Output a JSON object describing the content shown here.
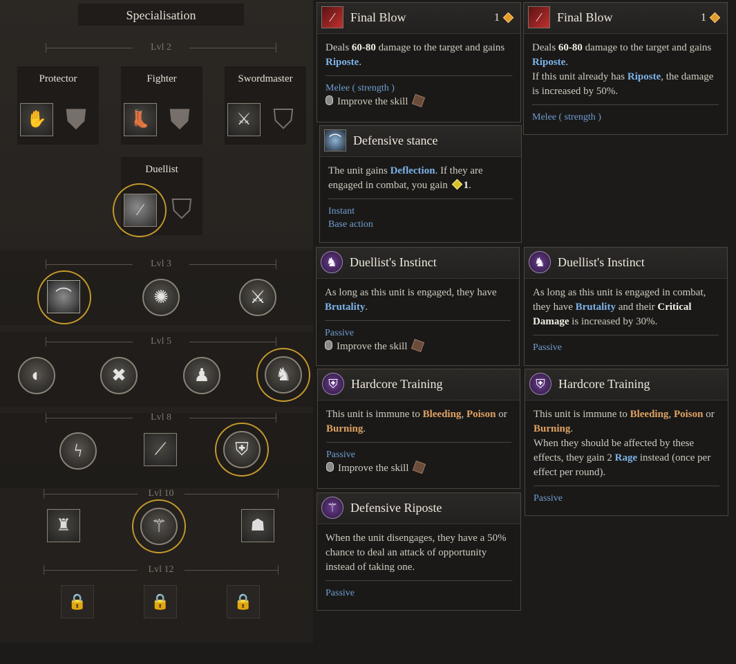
{
  "panel": {
    "title": "Specialisation",
    "levels": [
      "Lvl 2",
      "Lvl 3",
      "Lvl 5",
      "Lvl 8",
      "Lvl 10",
      "Lvl 12"
    ],
    "classes": [
      "Protector",
      "Fighter",
      "Swordmaster",
      "Duellist"
    ]
  },
  "tooltips": {
    "final_blow_1": {
      "title": "Final Blow",
      "cost": "1",
      "desc_pre": "Deals ",
      "desc_dmg": "60-80",
      "desc_mid": " damage to the target and gains ",
      "desc_kw": "Riposte",
      "desc_end": ".",
      "tag": "Melee ( strength )",
      "improve": "Improve the skill"
    },
    "final_blow_2": {
      "title": "Final Blow",
      "cost": "1",
      "desc_pre": "Deals ",
      "desc_dmg": "60-80",
      "desc_mid": " damage to the target and gains ",
      "desc_kw": "Riposte",
      "desc_end": ".",
      "desc2_pre": "If this unit already has ",
      "desc2_kw": "Riposte",
      "desc2_end": ", the damage is increased by 50%.",
      "tag": "Melee ( strength )"
    },
    "defensive_stance": {
      "title": "Defensive stance",
      "desc_pre": "The unit gains ",
      "desc_kw": "Deflection",
      "desc_mid": ". If they are engaged in combat, you gain ",
      "desc_num": "1",
      "desc_end": ".",
      "tag1": "Instant",
      "tag2": "Base action"
    },
    "duellists_instinct_1": {
      "title": "Duellist's Instinct",
      "desc_pre": "As long as this unit is engaged, they have ",
      "desc_kw": "Brutality",
      "desc_end": ".",
      "tag": "Passive",
      "improve": "Improve the skill"
    },
    "duellists_instinct_2": {
      "title": "Duellist's Instinct",
      "desc_pre": "As long as this unit is engaged in combat, they have ",
      "desc_kw": "Brutality",
      "desc_mid": " and their ",
      "desc_kw2": "Critical Damage",
      "desc_end": " is increased by 30%.",
      "tag": "Passive"
    },
    "hardcore_training_1": {
      "title": "Hardcore Training",
      "desc_pre": "This unit is immune to ",
      "kw1": "Bleeding",
      "sep1": ", ",
      "kw2": "Poison",
      "sep2": " or ",
      "kw3": "Burning",
      "desc_end": ".",
      "tag": "Passive",
      "improve": "Improve the skill"
    },
    "hardcore_training_2": {
      "title": "Hardcore Training",
      "desc_pre": "This unit is immune to ",
      "kw1": "Bleeding",
      "sep1": ", ",
      "kw2": "Poison",
      "sep2": " or ",
      "kw3": "Burning",
      "desc_end": ".",
      "desc2_pre": "When they should be affected by these effects, they gain 2 ",
      "desc2_kw": "Rage",
      "desc2_end": " instead (once per effect per round).",
      "tag": "Passive"
    },
    "defensive_riposte": {
      "title": "Defensive Riposte",
      "desc": "When the unit disengages, they have a 50% chance to deal an attack of opportunity instead of taking one.",
      "tag": "Passive"
    }
  }
}
